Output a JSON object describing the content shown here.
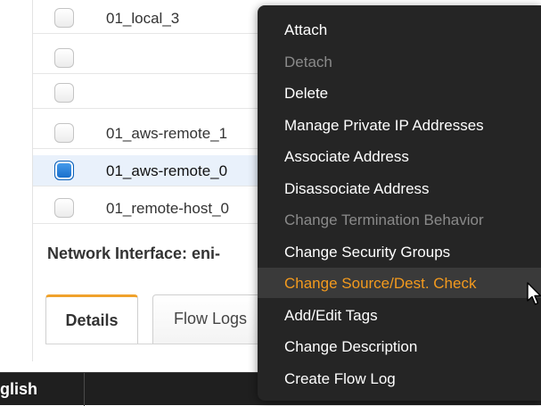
{
  "table": {
    "rows": [
      {
        "label": "01_local_3",
        "checked": false
      },
      {
        "label": "",
        "checked": false
      },
      {
        "label": "",
        "checked": false
      },
      {
        "label": "01_aws-remote_1",
        "checked": false
      },
      {
        "label": "01_aws-remote_0",
        "checked": true
      },
      {
        "label": "01_remote-host_0",
        "checked": false
      }
    ]
  },
  "detail": {
    "title": "Network Interface: eni-"
  },
  "tabs": [
    {
      "label": "Details",
      "active": true
    },
    {
      "label": "Flow Logs",
      "active": false
    }
  ],
  "bottombar": {
    "language": "glish"
  },
  "context_menu": {
    "items": [
      {
        "label": "Attach",
        "disabled": false
      },
      {
        "label": "Detach",
        "disabled": true
      },
      {
        "label": "Delete",
        "disabled": false
      },
      {
        "label": "Manage Private IP Addresses",
        "disabled": false
      },
      {
        "label": "Associate Address",
        "disabled": false
      },
      {
        "label": "Disassociate Address",
        "disabled": false
      },
      {
        "label": "Change Termination Behavior",
        "disabled": true
      },
      {
        "label": "Change Security Groups",
        "disabled": false
      },
      {
        "label": "Change Source/Dest. Check",
        "disabled": false,
        "hovered": true
      },
      {
        "label": "Add/Edit Tags",
        "disabled": false
      },
      {
        "label": "Change Description",
        "disabled": false
      },
      {
        "label": "Create Flow Log",
        "disabled": false
      }
    ]
  },
  "colors": {
    "menu_background": "#252525",
    "menu_hover_text": "#f39a1e",
    "tab_active_accent": "#f0a22b",
    "selected_row": "#e9f1fb",
    "checkbox_checked": "#1469c8"
  },
  "icons": {
    "cursor": "mouse-pointer-icon"
  }
}
